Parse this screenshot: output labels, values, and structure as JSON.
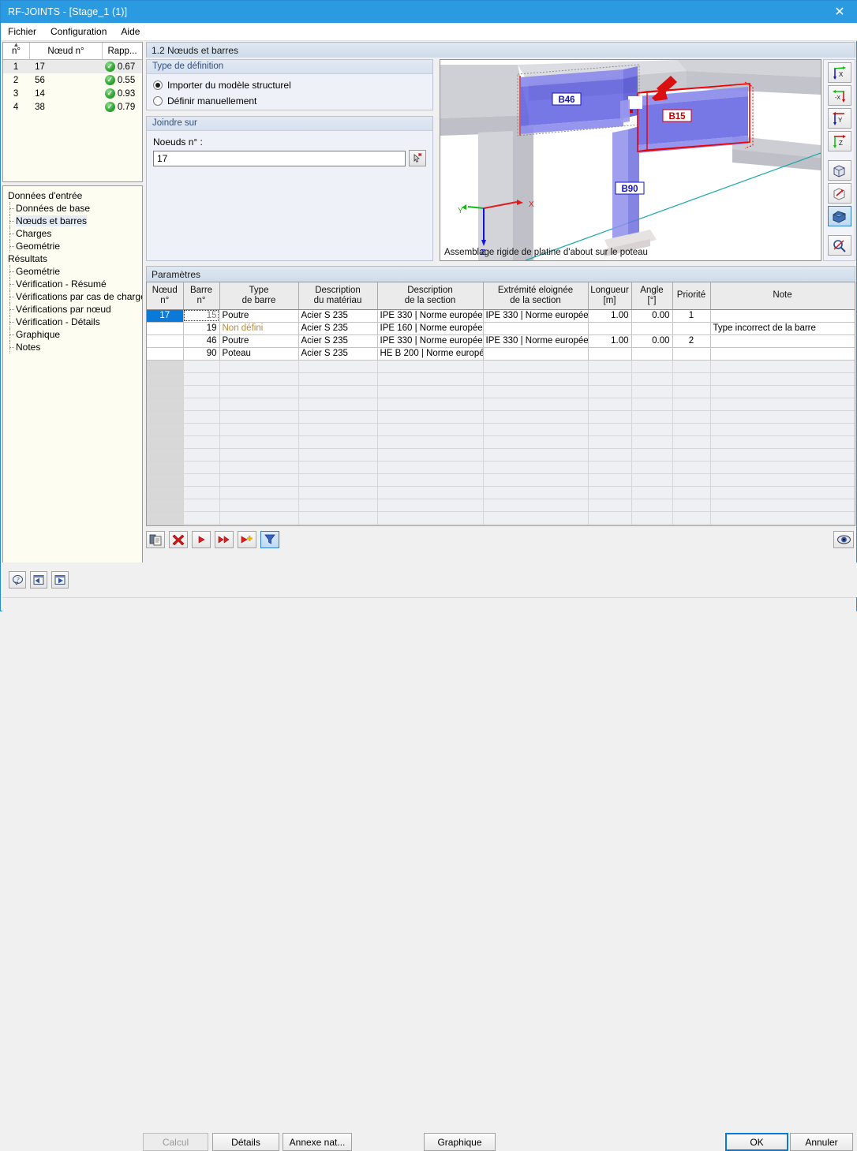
{
  "window": {
    "title": "RF-JOINTS - [Stage_1 (1)]",
    "close_icon": "close-icon",
    "accent": "#2a9ae1"
  },
  "menu": {
    "items": [
      "Fichier",
      "Configuration",
      "Aide"
    ]
  },
  "node_table": {
    "columns": [
      "n°",
      "Nœud n°",
      "Rapp..."
    ],
    "rows": [
      {
        "n": "1",
        "node": "17",
        "ratio": "0.67",
        "status": "ok"
      },
      {
        "n": "2",
        "node": "56",
        "ratio": "0.55",
        "status": "ok"
      },
      {
        "n": "3",
        "node": "14",
        "ratio": "0.93",
        "status": "ok"
      },
      {
        "n": "4",
        "node": "38",
        "ratio": "0.79",
        "status": "ok"
      }
    ],
    "selected_index": 0,
    "status_color": "#2e9e2e"
  },
  "tree": {
    "groups": [
      {
        "label": "Données d'entrée",
        "children": [
          "Données de base",
          "Nœuds et barres",
          "Charges",
          "Geométrie"
        ]
      },
      {
        "label": "Résultats",
        "children": [
          "Geométrie",
          "Vérification - Résumé",
          "Vérifications par cas de charge",
          "Vérifications par nœud",
          "Vérification - Détails",
          "Graphique",
          "Notes"
        ]
      }
    ],
    "selected": "Nœuds et barres",
    "scroll_left_icon": "chevron-left-icon",
    "scroll_right_icon": "chevron-right-icon"
  },
  "section": {
    "title": "1.2 Nœuds et barres"
  },
  "type_definition": {
    "title": "Type de définition",
    "options": [
      "Importer du modèle structurel",
      "Définir manuellement"
    ],
    "selected": 0
  },
  "joindre": {
    "title": "Joindre sur",
    "field_label": "Noeuds n° :",
    "value": "17",
    "placeholder": "",
    "pick_icon": "pick-node-icon"
  },
  "viewer": {
    "caption": "Assemblage rigide de platine d'about sur le poteau",
    "member_labels": [
      "B46",
      "B15",
      "B90"
    ],
    "axes": [
      "X",
      "Y",
      "Z"
    ],
    "axis_colors": {
      "x": "#e01b1b",
      "y": "#11bb11",
      "z": "#1212d8"
    },
    "selected_member": "B15",
    "member_color": "#5a5ce0",
    "highlight_color": "#ee0000",
    "tools": [
      {
        "name": "view-x-icon",
        "label": "X",
        "active": false
      },
      {
        "name": "view-minus-x-icon",
        "label": "-X",
        "active": false
      },
      {
        "name": "view-y-icon",
        "label": "Y",
        "active": false
      },
      {
        "name": "view-z-icon",
        "label": "Z",
        "active": false
      },
      {
        "name": "isometric-cube-icon",
        "label": "",
        "active": false
      },
      {
        "name": "rotate-cube-icon",
        "label": "",
        "active": false
      },
      {
        "name": "render-solid-icon",
        "label": "",
        "active": true
      },
      {
        "name": "zoom-search-icon",
        "label": "",
        "active": false
      }
    ]
  },
  "parameters": {
    "title": "Paramètres",
    "columns": [
      {
        "l1": "Nœud",
        "l2": "n°"
      },
      {
        "l1": "Barre",
        "l2": "n°"
      },
      {
        "l1": "Type",
        "l2": "de barre"
      },
      {
        "l1": "Description",
        "l2": "du matériau"
      },
      {
        "l1": "Description",
        "l2": "de la section"
      },
      {
        "l1": "Extrémité eloignée",
        "l2": "de la section"
      },
      {
        "l1": "Longueur",
        "l2": "[m]"
      },
      {
        "l1": "Angle",
        "l2": "[°]"
      },
      {
        "l1": "Priorité",
        "l2": ""
      },
      {
        "l1": "Note",
        "l2": ""
      }
    ],
    "rows": [
      {
        "node": "17",
        "node_selected": true,
        "bar": "15",
        "bar_focus": true,
        "type": "Poutre",
        "type_undefined": false,
        "material": "Acier S 235",
        "section": "IPE 330 | Norme europée",
        "far_end": "IPE 330 | Norme europée",
        "length": "1.00",
        "angle": "0.00",
        "priority": "1",
        "note": ""
      },
      {
        "node": "",
        "node_selected": false,
        "bar": "19",
        "bar_focus": false,
        "type": "Non défini",
        "type_undefined": true,
        "material": "Acier S 235",
        "section": "IPE 160 | Norme europée",
        "far_end": "",
        "length": "",
        "angle": "",
        "priority": "",
        "note": "Type incorrect de la barre"
      },
      {
        "node": "",
        "node_selected": false,
        "bar": "46",
        "bar_focus": false,
        "type": "Poutre",
        "type_undefined": false,
        "material": "Acier S 235",
        "section": "IPE 330 | Norme europée",
        "far_end": "IPE 330 | Norme europée",
        "length": "1.00",
        "angle": "0.00",
        "priority": "2",
        "note": ""
      },
      {
        "node": "",
        "node_selected": false,
        "bar": "90",
        "bar_focus": false,
        "type": "Poteau",
        "type_undefined": false,
        "material": "Acier S 235",
        "section": "HE B 200 | Norme europé",
        "far_end": "",
        "length": "",
        "angle": "",
        "priority": "",
        "note": ""
      }
    ],
    "empty_rows": 15,
    "toolbar": [
      {
        "name": "copy-paste-icon",
        "active": false
      },
      {
        "name": "delete-red-x-icon",
        "active": false
      },
      {
        "name": "next-arrow-icon",
        "active": false
      },
      {
        "name": "fast-forward-icon",
        "active": false
      },
      {
        "name": "add-arrow-icon",
        "active": false
      },
      {
        "name": "filter-funnel-icon",
        "active": true
      }
    ],
    "visibility_icon": "eye-icon"
  },
  "footer": {
    "icons": [
      {
        "name": "help-balloon-icon"
      },
      {
        "name": "prev-panel-icon"
      },
      {
        "name": "next-panel-icon"
      }
    ],
    "buttons": [
      {
        "name": "calcul-button",
        "label": "Calcul",
        "disabled": true
      },
      {
        "name": "details-button",
        "label": "Détails",
        "disabled": false
      },
      {
        "name": "annexe-nat-button",
        "label": "Annexe nat...",
        "disabled": false
      },
      {
        "name": "graphique-button",
        "label": "Graphique",
        "disabled": false
      }
    ],
    "ok_label": "OK",
    "cancel_label": "Annuler"
  }
}
